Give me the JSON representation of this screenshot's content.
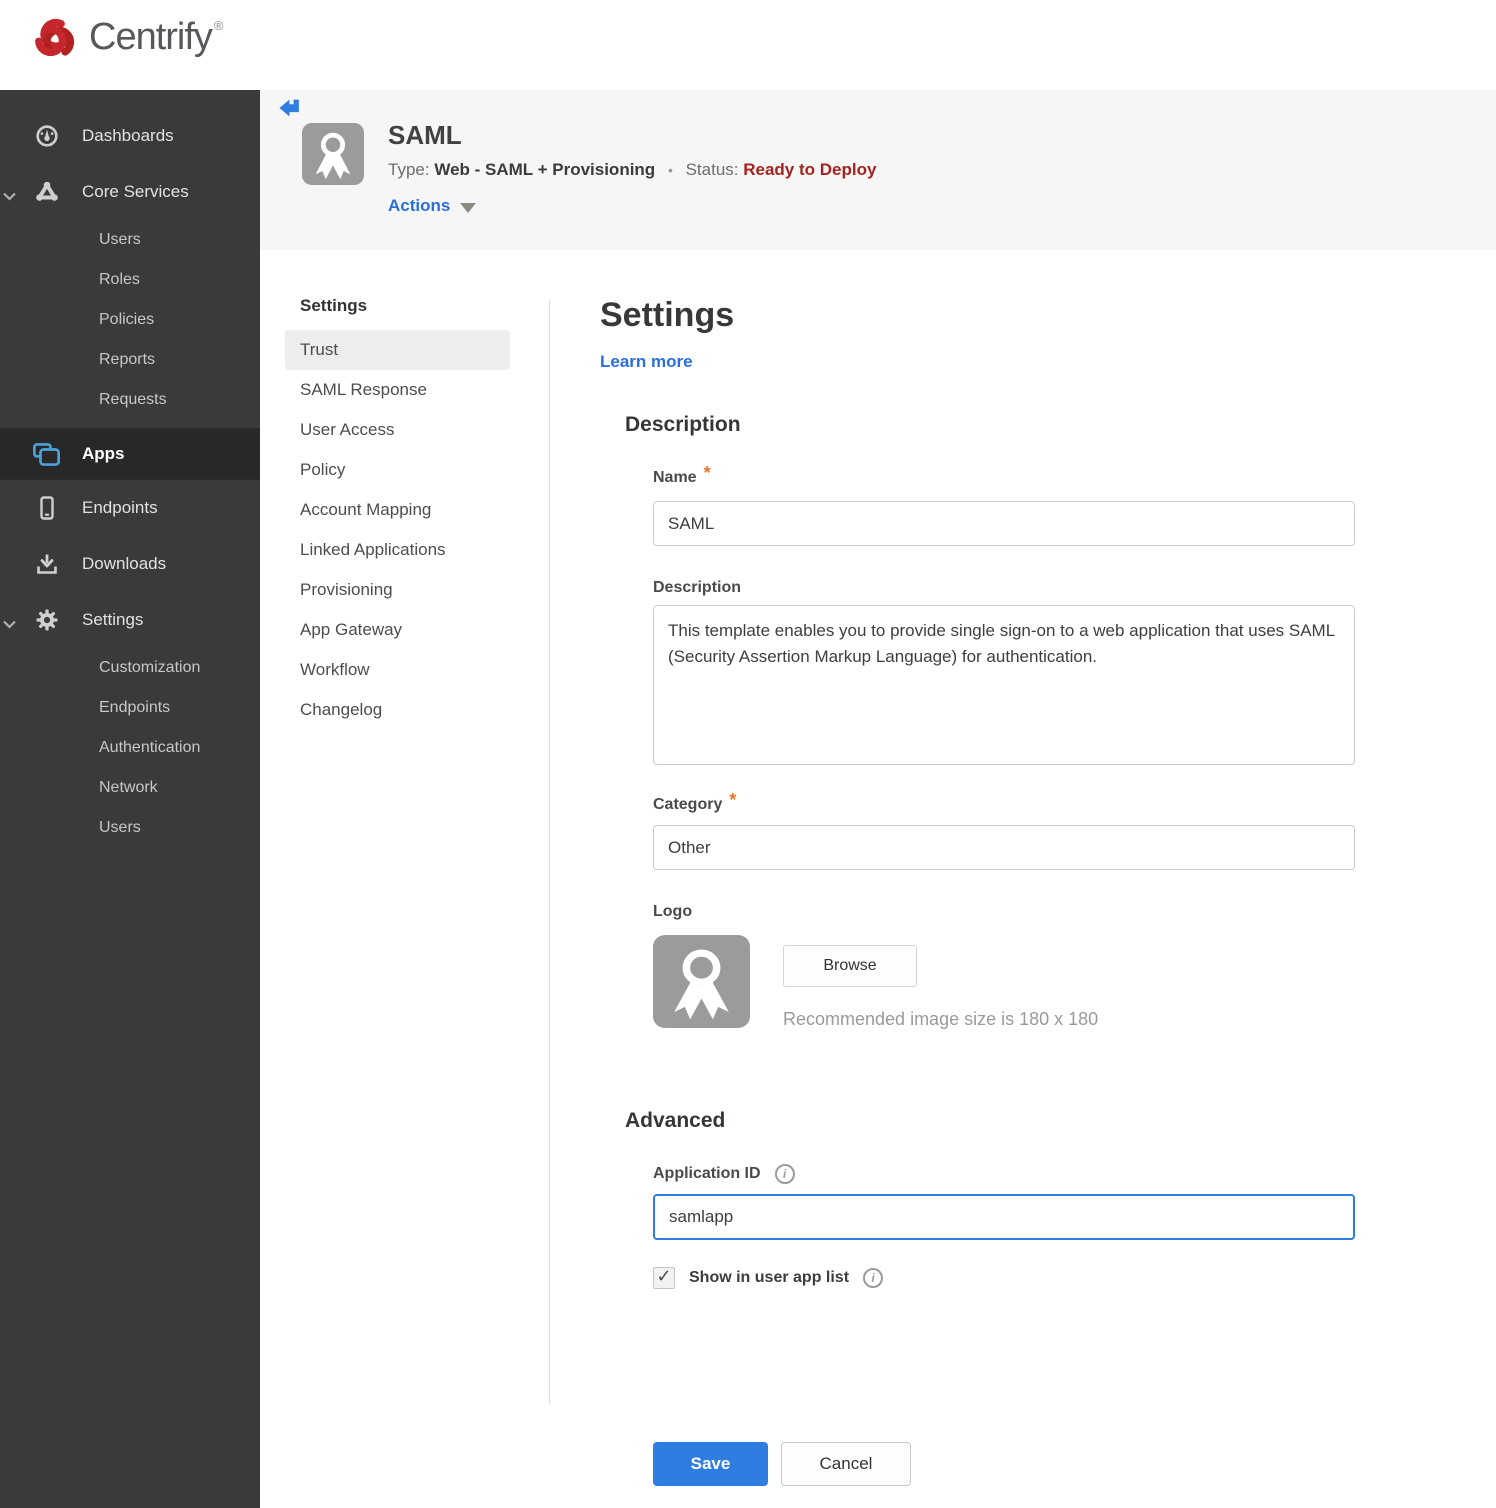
{
  "brand": {
    "name": "Centrify",
    "reg": "®"
  },
  "colors": {
    "accent_blue": "#2f7de1",
    "apps_icon_blue": "#4aa2dd",
    "status_red": "#a3231f",
    "required_orange": "#e8772e",
    "brand_red": "#c5272c",
    "sidebar_bg": "#3a3a3a",
    "sidebar_active_bg": "#282828",
    "header_band_bg": "#f6f6f6"
  },
  "icons": {
    "back": "arrow-left",
    "dashboards": "gauge",
    "core_services": "nodes-triangle",
    "apps": "stacked-windows",
    "endpoints": "smartphone",
    "downloads": "download-tray",
    "settings": "gear",
    "app_logo": "ribbon-badge",
    "info": "i",
    "actions_caret": "▼",
    "expanded_chevron": "⌄",
    "check": "✓",
    "bullet": "•"
  },
  "sidebar": {
    "items": [
      {
        "label": "Dashboards"
      },
      {
        "label": "Core Services",
        "expanded": true
      },
      {
        "label": "Users"
      },
      {
        "label": "Roles"
      },
      {
        "label": "Policies"
      },
      {
        "label": "Reports"
      },
      {
        "label": "Requests"
      },
      {
        "label": "Apps",
        "active": true
      },
      {
        "label": "Endpoints"
      },
      {
        "label": "Downloads"
      },
      {
        "label": "Settings",
        "expanded": true
      },
      {
        "label": "Customization"
      },
      {
        "label": "Endpoints"
      },
      {
        "label": "Authentication"
      },
      {
        "label": "Network"
      },
      {
        "label": "Users"
      }
    ]
  },
  "app_header": {
    "title": "SAML",
    "type_label": "Type:",
    "type_value": "Web - SAML + Provisioning",
    "separator": "•",
    "status_label": "Status:",
    "status_value": "Ready to Deploy",
    "actions_label": "Actions"
  },
  "subnav": {
    "header": "Settings",
    "selected": "Trust",
    "items": [
      "Trust",
      "SAML Response",
      "User Access",
      "Policy",
      "Account Mapping",
      "Linked Applications",
      "Provisioning",
      "App Gateway",
      "Workflow",
      "Changelog"
    ]
  },
  "main": {
    "title": "Settings",
    "learn_more": "Learn more",
    "required_marker": "*",
    "description": {
      "heading": "Description",
      "name_label": "Name",
      "name_value": "SAML",
      "description_label": "Description",
      "description_value": "This template enables you to provide single sign-on to a web application that uses SAML (Security Assertion Markup Language) for authentication.",
      "category_label": "Category",
      "category_value": "Other",
      "logo_label": "Logo",
      "browse_label": "Browse",
      "recommended_text": "Recommended image size is 180 x 180"
    },
    "advanced": {
      "heading": "Advanced",
      "app_id_label": "Application ID",
      "app_id_value": "samlapp",
      "show_label": "Show in user app list",
      "checkbox_checked": true,
      "check_glyph": "✓",
      "info_glyph": "i"
    },
    "buttons": {
      "save": "Save",
      "cancel": "Cancel"
    }
  }
}
